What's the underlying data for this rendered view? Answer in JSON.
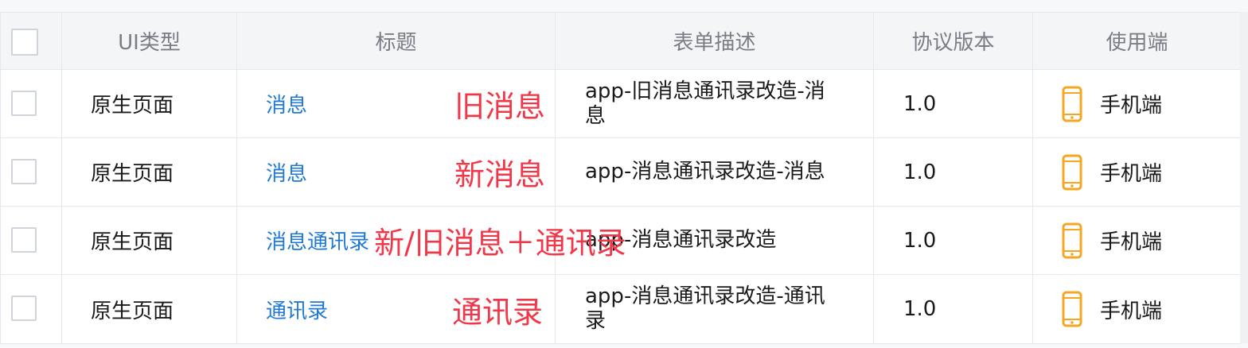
{
  "table": {
    "headers": {
      "ui_type": "UI类型",
      "title": "标题",
      "desc": "表单描述",
      "version": "协议版本",
      "endpoint": "使用端"
    },
    "rows": [
      {
        "ui_type": "原生页面",
        "title": "消息",
        "annotation": "旧消息",
        "desc": "app-旧消息通讯录改造-消息",
        "version": "1.0",
        "endpoint": "手机端",
        "endpoint_icon": "mobile-phone-icon"
      },
      {
        "ui_type": "原生页面",
        "title": "消息",
        "annotation": "新消息",
        "desc": "app-消息通讯录改造-消息",
        "version": "1.0",
        "endpoint": "手机端",
        "endpoint_icon": "mobile-phone-icon"
      },
      {
        "ui_type": "原生页面",
        "title": "消息通讯录",
        "annotation": "新/旧消息＋通讯录",
        "desc": "app-消息通讯录改造",
        "version": "1.0",
        "endpoint": "手机端",
        "endpoint_icon": "mobile-phone-icon"
      },
      {
        "ui_type": "原生页面",
        "title": "通讯录",
        "annotation": "通讯录",
        "desc": "app-消息通讯录改造-通讯录",
        "version": "1.0",
        "endpoint": "手机端",
        "endpoint_icon": "mobile-phone-icon"
      }
    ]
  },
  "colors": {
    "link": "#1f7ad6",
    "annotation": "#f0384a",
    "phone_icon": "#f5a623",
    "header_bg": "#f4f5f7",
    "border": "#e5e8ec"
  }
}
